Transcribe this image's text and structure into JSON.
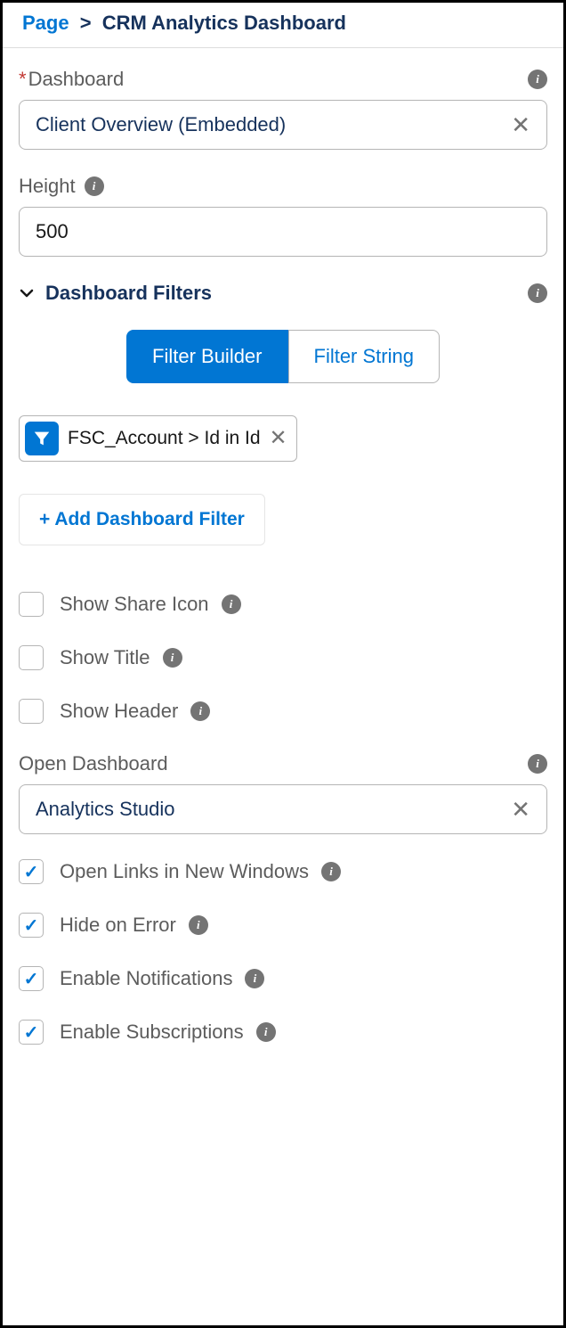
{
  "breadcrumb": {
    "root": "Page",
    "sep": ">",
    "current": "CRM Analytics Dashboard"
  },
  "dashboard": {
    "label": "Dashboard",
    "value": "Client Overview (Embedded)"
  },
  "height": {
    "label": "Height",
    "value": "500"
  },
  "filters": {
    "section_label": "Dashboard Filters",
    "tab_builder": "Filter Builder",
    "tab_string": "Filter String",
    "chip_text": "FSC_Account > Id in Id",
    "add_label": "+ Add Dashboard Filter"
  },
  "checks": {
    "share": {
      "label": "Show Share Icon",
      "checked": false,
      "info": true
    },
    "title": {
      "label": "Show Title",
      "checked": false,
      "info": true
    },
    "header": {
      "label": "Show Header",
      "checked": false,
      "info": true
    }
  },
  "open_dashboard": {
    "label": "Open Dashboard",
    "value": "Analytics Studio"
  },
  "checks2": {
    "open_links": {
      "label": "Open Links in New Windows",
      "checked": true,
      "info": true
    },
    "hide_error": {
      "label": "Hide on Error",
      "checked": true,
      "info": true
    },
    "notifications": {
      "label": "Enable Notifications",
      "checked": true,
      "info": true
    },
    "subscriptions": {
      "label": "Enable Subscriptions",
      "checked": true,
      "info": true
    }
  }
}
